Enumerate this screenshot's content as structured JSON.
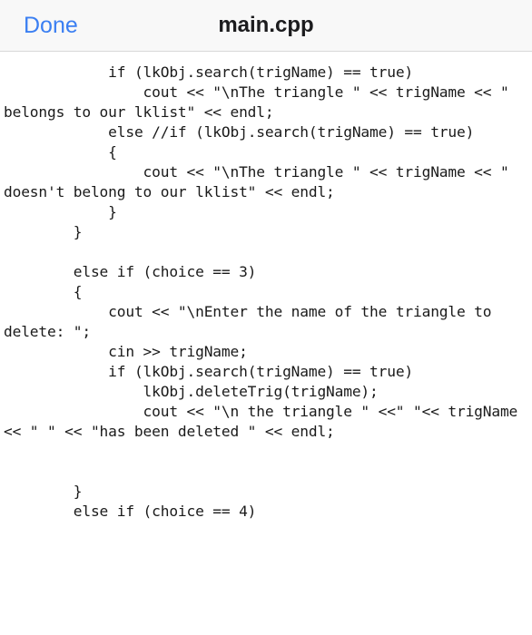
{
  "navbar": {
    "done_label": "Done",
    "title": "main.cpp",
    "done_color": "#3b7ff2",
    "title_color": "#1c1c1e",
    "background": "#f8f8f8"
  },
  "document": {
    "filename": "main.cpp",
    "language": "cpp",
    "text_color": "#1a1a1a",
    "background": "#ffffff",
    "wrap": true,
    "lines": [
      "            if (lkObj.search(trigName) == true)",
      "                cout << \"\\nThe triangle \" << trigName << \" belongs to our lklist\" << endl;",
      "            else //if (lkObj.search(trigName) == true)",
      "            {",
      "                cout << \"\\nThe triangle \" << trigName << \" doesn't belong to our lklist\" << endl;",
      "            }",
      "        }",
      "",
      "        else if (choice == 3)",
      "        {",
      "            cout << \"\\nEnter the name of the triangle to delete: \";",
      "            cin >> trigName;",
      "            if (lkObj.search(trigName) == true)",
      "                lkObj.deleteTrig(trigName);",
      "                cout << \"\\n the triangle \" <<\" \"<< trigName << \" \" << \"has been deleted \" << endl;",
      "",
      "",
      "        }",
      "        else if (choice == 4)"
    ],
    "content": "            if (lkObj.search(trigName) == true)\n                cout << \"\\nThe triangle \" << trigName << \" belongs to our lklist\" << endl;\n            else //if (lkObj.search(trigName) == true)\n            {\n                cout << \"\\nThe triangle \" << trigName << \" doesn't belong to our lklist\" << endl;\n            }\n        }\n\n        else if (choice == 3)\n        {\n            cout << \"\\nEnter the name of the triangle to delete: \";\n            cin >> trigName;\n            if (lkObj.search(trigName) == true)\n                lkObj.deleteTrig(trigName);\n                cout << \"\\n the triangle \" <<\" \"<< trigName << \" \" << \"has been deleted \" << endl;\n\n\n        }\n        else if (choice == 4)"
  }
}
